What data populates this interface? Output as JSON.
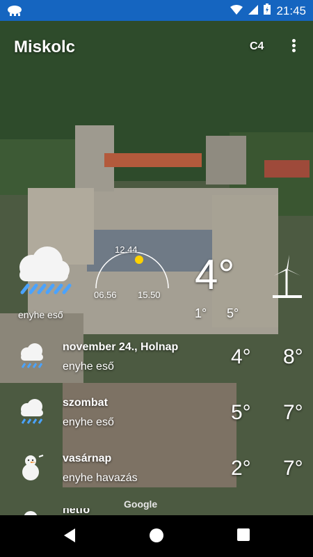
{
  "status_bar": {
    "time": "21:45",
    "icons": [
      "cloud-rain-icon",
      "wifi-icon",
      "signal-icon",
      "battery-charging-icon"
    ]
  },
  "app_bar": {
    "city": "Miskolc",
    "unit_toggle": "C4",
    "menu_icon": "more-vert-icon"
  },
  "current": {
    "temperature": "4°",
    "condition": "enyhe eső",
    "icon": "rain-cloud-icon",
    "sun_arc": {
      "noon": "12.44",
      "sunrise": "06.56",
      "sunset": "15.50"
    },
    "min": "1°",
    "max": "5°",
    "wind_icon": "wind-turbine-icon"
  },
  "forecast": [
    {
      "day": "november 24., Holnap",
      "condition": "enyhe eső",
      "low": "4°",
      "high": "8°",
      "icon": "rain-cloud-icon"
    },
    {
      "day": "szombat",
      "condition": "enyhe eső",
      "low": "5°",
      "high": "7°",
      "icon": "rain-cloud-icon"
    },
    {
      "day": "vasárnap",
      "condition": "enyhe havazás",
      "low": "2°",
      "high": "7°",
      "icon": "snowman-icon"
    },
    {
      "day": "hétfő",
      "condition": "",
      "low": "",
      "high": "",
      "icon": "weather-icon"
    }
  ],
  "attribution": "Google",
  "colors": {
    "status_bar": "#1565c0",
    "rain_drops": "#4aa3ff",
    "sun": "#ffd200"
  }
}
